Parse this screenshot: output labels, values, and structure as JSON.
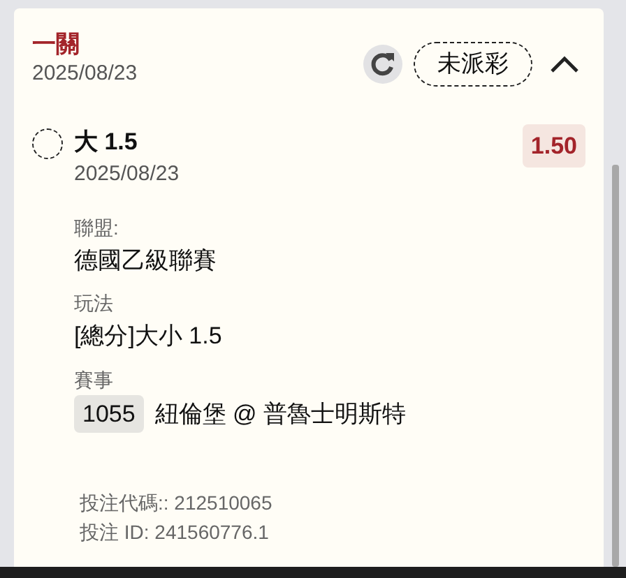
{
  "header": {
    "title": "一關",
    "date": "2025/08/23",
    "status": "未派彩",
    "expanded": true
  },
  "selection": {
    "selected": false,
    "name": "大 1.5",
    "date": "2025/08/23",
    "odds": "1.50"
  },
  "details": [
    {
      "kind": "text",
      "label": "聯盟:",
      "value": "德國乙級聯賽"
    },
    {
      "kind": "text",
      "label": "玩法",
      "value": "[總分]大小 1.5"
    },
    {
      "kind": "match",
      "label": "賽事",
      "code": "1055",
      "value": "紐倫堡 @ 普魯士明斯特"
    }
  ],
  "footer": [
    "投注代碼:: 212510065",
    "投注 ID: 241560776.1"
  ]
}
